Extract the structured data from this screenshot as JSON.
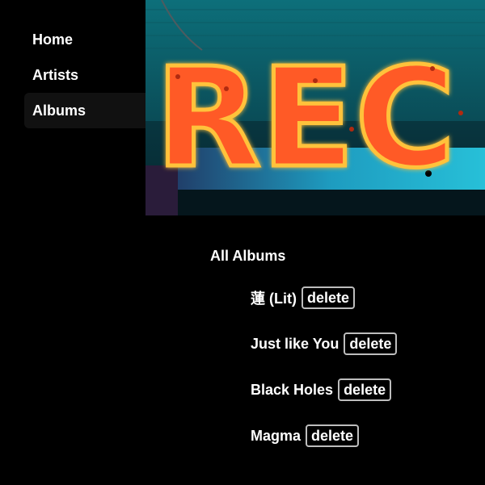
{
  "nav": {
    "items": [
      {
        "label": "Home",
        "active": false
      },
      {
        "label": "Artists",
        "active": false
      },
      {
        "label": "Albums",
        "active": true
      }
    ]
  },
  "hero": {
    "sign_text": "REC",
    "colors": {
      "wall": "#0f5a66",
      "neon": "#ff5a28",
      "neon_glow": "#ffc23a",
      "base": "#1e9cc0"
    }
  },
  "albums": {
    "title": "All Albums",
    "delete_label": "delete",
    "items": [
      {
        "title": "蓮 (Lit)"
      },
      {
        "title": "Just like You"
      },
      {
        "title": "Black Holes"
      },
      {
        "title": "Magma"
      }
    ]
  }
}
